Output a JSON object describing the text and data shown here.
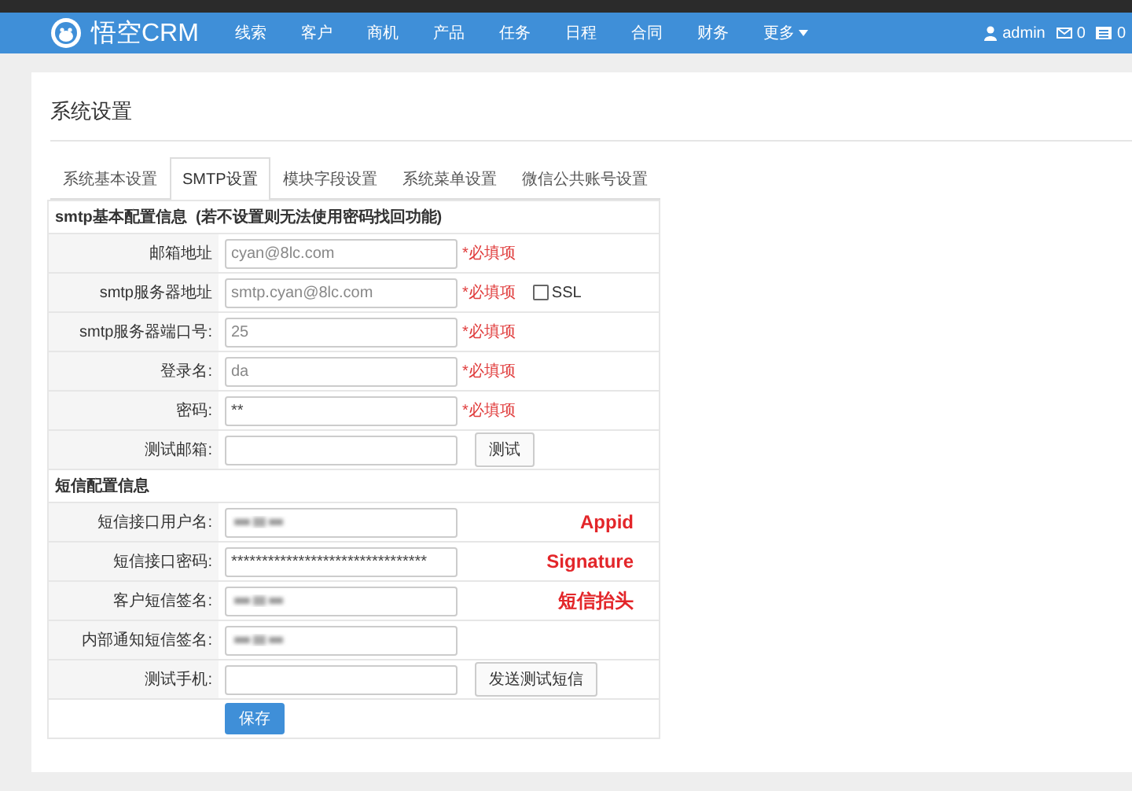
{
  "navbar": {
    "brand": "悟空CRM",
    "items": [
      "线索",
      "客户",
      "商机",
      "产品",
      "任务",
      "日程",
      "合同",
      "财务",
      "更多"
    ],
    "user": "admin",
    "mail_count": "0",
    "task_count": "0"
  },
  "page": {
    "title": "系统设置"
  },
  "tabs": [
    {
      "label": "系统基本设置",
      "selected": false
    },
    {
      "label": "SMTP设置",
      "selected": true
    },
    {
      "label": "模块字段设置",
      "selected": false
    },
    {
      "label": "系统菜单设置",
      "selected": false
    },
    {
      "label": "微信公共账号设置",
      "selected": false
    }
  ],
  "form": [
    {
      "kind": "section",
      "title": "smtp基本配置信息",
      "note": "(若不设置则无法使用密码找回功能)"
    },
    {
      "kind": "field",
      "label": "邮箱地址",
      "placeholder": "cyan@8lc.com",
      "required": "*必填项"
    },
    {
      "kind": "field",
      "label": "smtp服务器地址",
      "placeholder": "smtp.cyan@8lc.com",
      "required": "*必填项",
      "checkbox": {
        "label": "SSL",
        "checked": false
      }
    },
    {
      "kind": "field",
      "label": "smtp服务器端口号:",
      "placeholder": "25",
      "required": "*必填项"
    },
    {
      "kind": "field",
      "label": "登录名:",
      "placeholder": "da",
      "required": "*必填项"
    },
    {
      "kind": "field",
      "label": "密码:",
      "value": "**",
      "required": "*必填项"
    },
    {
      "kind": "field",
      "label": "测试邮箱:",
      "button": "测试"
    },
    {
      "kind": "section",
      "title": "短信配置信息"
    },
    {
      "kind": "field",
      "label": "短信接口用户名:",
      "blurred": true,
      "annotation": "Appid"
    },
    {
      "kind": "field",
      "label": "短信接口密码:",
      "value": "********************************",
      "annotation": "Signature"
    },
    {
      "kind": "field",
      "label": "客户短信签名:",
      "blurred": true,
      "annotation": "短信抬头"
    },
    {
      "kind": "field",
      "label": "内部通知短信签名:",
      "blurred": true
    },
    {
      "kind": "field",
      "label": "测试手机:",
      "button": "发送测试短信"
    },
    {
      "kind": "submit",
      "button": "保存"
    }
  ]
}
